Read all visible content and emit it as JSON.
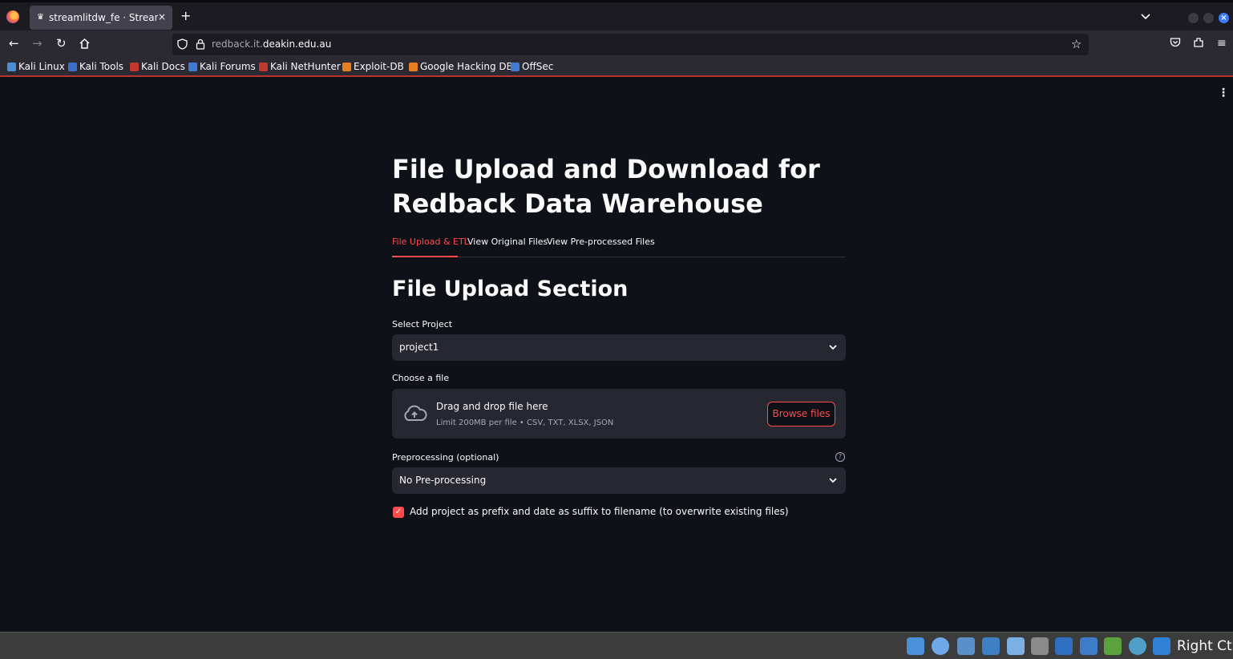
{
  "browser": {
    "tab_title": "streamlitdw_fe · Streamlit",
    "tab_close": "×",
    "new_tab": "+",
    "url_prefix": "redback.it.",
    "url_host": "deakin.edu.au",
    "bookmarks": [
      {
        "label": "Kali Linux",
        "color": "#4a8ed6"
      },
      {
        "label": "Kali Tools",
        "color": "#3b6fc9"
      },
      {
        "label": "Kali Docs",
        "color": "#c0392b"
      },
      {
        "label": "Kali Forums",
        "color": "#3e7bd1"
      },
      {
        "label": "Kali NetHunter",
        "color": "#c0392b"
      },
      {
        "label": "Exploit-DB",
        "color": "#e67e22"
      },
      {
        "label": "Google Hacking DB",
        "color": "#e67e22"
      },
      {
        "label": "OffSec",
        "color": "#3e7bd1"
      }
    ]
  },
  "app": {
    "title": "File Upload and Download for Redback Data Warehouse",
    "tabs": [
      {
        "label": "File Upload & ETL",
        "active": true
      },
      {
        "label": "View Original Files",
        "active": false
      },
      {
        "label": "View Pre-processed Files",
        "active": false
      }
    ],
    "section_title": "File Upload Section",
    "project_label": "Select Project",
    "project_value": "project1",
    "file_label": "Choose a file",
    "dropzone_title": "Drag and drop file here",
    "dropzone_sub": "Limit 200MB per file • CSV, TXT, XLSX, JSON",
    "browse_label": "Browse files",
    "preprocessing_label": "Preprocessing (optional)",
    "preprocessing_value": "No Pre-processing",
    "checkbox_label": "Add project as prefix and date as suffix to filename (to overwrite existing files)",
    "checkbox_checked": true,
    "accent_color": "#ff4b4b"
  },
  "taskbar": {
    "right_ctrl": "Right Ctrl"
  }
}
